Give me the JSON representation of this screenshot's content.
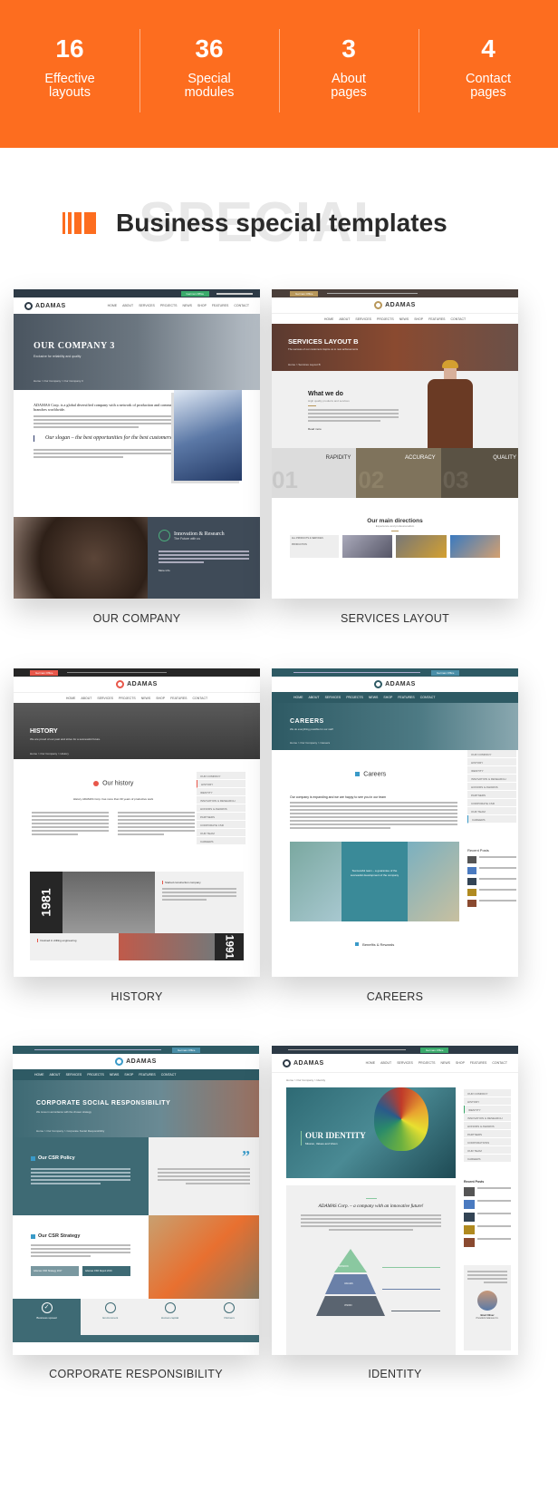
{
  "colors": {
    "accent": "#fd6d1f",
    "heading_text": "#2a2a2a",
    "watermark": "#e8e8e8"
  },
  "stats": [
    {
      "number": "16",
      "label_line1": "Effective",
      "label_line2": "layouts"
    },
    {
      "number": "36",
      "label_line1": "Special",
      "label_line2": "modules"
    },
    {
      "number": "3",
      "label_line1": "About",
      "label_line2": "pages"
    },
    {
      "number": "4",
      "label_line1": "Contact",
      "label_line2": "pages"
    }
  ],
  "section": {
    "watermark": "SPECIAL",
    "title": "Business special templates"
  },
  "templates": [
    {
      "caption": "OUR COMPANY",
      "brand": "ADAMAS",
      "office": "German Office",
      "hero_title": "OUR COMPANY 3",
      "hero_subtitle": "Exclusive for reliability and quality",
      "breadcrumb": "Home > Our Company > Our Company 3",
      "intro": "ADAMAS Corp. is a global diversified company with a network of production and commercial branches worldwide.",
      "quote": "Our slogan – the best opportunities for the best customers!",
      "feature_title": "Innovation & Research",
      "feature_subtitle": "The Future with us",
      "feature_link": "More info",
      "nav": [
        "HOME",
        "ABOUT",
        "SERVICES",
        "PROJECTS",
        "NEWS",
        "SHOP",
        "FEATURES",
        "CONTACT"
      ]
    },
    {
      "caption": "SERVICES LAYOUT",
      "brand": "ADAMAS",
      "office": "German Office",
      "hero_title": "SERVICES LAYOUT B",
      "hero_subtitle": "The success of our customers inspire us to new achievements",
      "breadcrumb": "Home > Services Layout B",
      "section_title": "What we do",
      "section_subtitle": "High quality products and services",
      "read_more": "Read more",
      "features": [
        {
          "num": "01",
          "title": "RAPIDITY"
        },
        {
          "num": "02",
          "title": "ACCURACY"
        },
        {
          "num": "03",
          "title": "QUALITY"
        }
      ],
      "directions_title": "Our main directions",
      "directions_subtitle": "Experience and professionalism",
      "directions_menu": [
        "ALL PRODUCTS & SERVICES",
        "PRODUCTION"
      ],
      "nav": [
        "HOME",
        "ABOUT",
        "SERVICES",
        "PROJECTS",
        "NEWS",
        "SHOP",
        "FEATURES",
        "CONTACT"
      ]
    },
    {
      "caption": "HISTORY",
      "brand": "ADAMAS",
      "office": "German Office",
      "hero_title": "HISTORY",
      "hero_subtitle": "We are proud of our past and strive for a successful future.",
      "breadcrumb": "Home > Our Company > History",
      "section_title": "Our history",
      "section_lead": "History ADAMAS Corp. has more than 30 years of productive work",
      "sidebar": [
        "OUR COMPANY",
        "HISTORY",
        "IDENTITY",
        "INNOVATION & RESEARCH",
        "HONORS & AWARDS",
        "PARTNERS",
        "CORPORATE CSR",
        "OUR TEAM",
        "CAREERS"
      ],
      "year1": "1981",
      "event1": "Started construction company",
      "event2": "Involved in drilling engineering",
      "year2": "1991",
      "nav": [
        "HOME",
        "ABOUT",
        "SERVICES",
        "PROJECTS",
        "NEWS",
        "SHOP",
        "FEATURES",
        "CONTACT"
      ]
    },
    {
      "caption": "CAREERS",
      "brand": "ADAMAS",
      "office": "German Office",
      "hero_title": "CAREERS",
      "hero_subtitle": "We do everything possible for our staff",
      "breadcrumb": "Home > Our Company > Careers",
      "section_title": "Careers",
      "lead": "Our company is expanding and we are happy to see you in our team",
      "quote": "Successful team – a guarantee of the successful development of the company",
      "recent_posts_title": "Recent Posts",
      "benefits_title": "Benefits & Rewards",
      "sidebar": [
        "OUR COMPANY",
        "HISTORY",
        "IDENTITY",
        "INNOVATION & RESEARCH",
        "HONORS & AWARDS",
        "PARTNERS",
        "CORPORATE CSR",
        "OUR TEAM",
        "CAREERS"
      ],
      "nav": [
        "HOME",
        "ABOUT",
        "SERVICES",
        "PROJECTS",
        "NEWS",
        "SHOP",
        "FEATURES",
        "CONTACT"
      ]
    },
    {
      "caption": "CORPORATE RESPONSIBILITY",
      "brand": "ADAMAS",
      "office": "German Office",
      "hero_title": "CORPORATE SOCIAL RESPONSIBILITY",
      "hero_subtitle": "We move in accordance with the chosen strategy",
      "breadcrumb": "Home > Our Company > Corporate Social Responsibility",
      "policy_title": "Our CSR Policy",
      "strategy_title": "Our CSR Strategy",
      "buttons": [
        "Adamas CSR Strategy 2017",
        "Adamas CSR Report 2016"
      ],
      "tabs": [
        "Business spread",
        "Environment",
        "Human capital",
        "Partners"
      ],
      "nav": [
        "HOME",
        "ABOUT",
        "SERVICES",
        "PROJECTS",
        "NEWS",
        "SHOP",
        "FEATURES",
        "CONTACT"
      ]
    },
    {
      "caption": "IDENTITY",
      "brand": "ADAMAS",
      "office": "German Office",
      "breadcrumb": "Home > Our Company > Identity",
      "hero_title": "OUR IDENTITY",
      "hero_subtitle": "Mission, Values and Vision",
      "lead": "ADAMAS Corp. – a company with an innovative future!",
      "pyramid": [
        "MISSION",
        "VALUES",
        "VISION"
      ],
      "sidebar": [
        "OUR COMPANY",
        "HISTORY",
        "IDENTITY",
        "INNOVATION & RESEARCH",
        "HONORS & AWARDS",
        "PARTNERS",
        "CORPORATIONS",
        "OUR TEAM",
        "CAREERS"
      ],
      "recent_posts_title": "Recent Posts",
      "person_name": "Brad Oliver",
      "person_role": "President Adamas Co.",
      "nav": [
        "HOME",
        "ABOUT",
        "SERVICES",
        "PROJECTS",
        "NEWS",
        "SHOP",
        "FEATURES",
        "CONTACT"
      ]
    }
  ]
}
